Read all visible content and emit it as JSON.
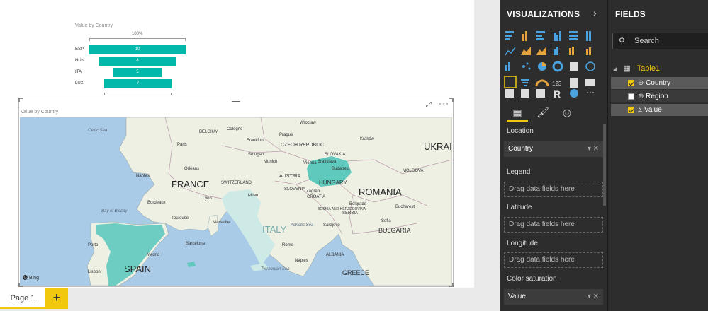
{
  "funnel": {
    "title": "Value by Country",
    "top_label": "100%",
    "rows": [
      {
        "label": "ESP",
        "value": "10"
      },
      {
        "label": "HUN",
        "value": "8"
      },
      {
        "label": "ITA",
        "value": "5"
      },
      {
        "label": "LUX",
        "value": "7"
      }
    ]
  },
  "map_visual": {
    "title": "Value by Country",
    "provider": "Bing",
    "labels": {
      "france": "FRANCE",
      "spain": "SPAIN",
      "italy": "ITALY",
      "hungary": "HUNGARY",
      "romania": "ROMANIA",
      "bulgaria": "BULGARIA",
      "greece": "GREECE",
      "austria": "AUSTRIA",
      "switzerland": "SWITZERLAND",
      "czech": "CZECH REPUBLIC",
      "slovakia": "SLOVAKIA",
      "serbia": "SERBIA",
      "croatia": "CROATIA",
      "belgium": "BELGIUM",
      "ukraine": "UKRAI",
      "slovenia": "SLOVENIA",
      "bosnia": "BOSNIA AND HERZEGOVINA",
      "albania": "ALBANIA",
      "moldova": "MOLDOVA",
      "celtic": "Celtic Sea",
      "biscay": "Bay of Biscay",
      "tyrrhenian": "Tyrrhenian Sea",
      "adriatic": "Adriatic Sea",
      "paris": "Paris",
      "madrid": "Madrid",
      "rome": "Rome",
      "vienna": "Vienna",
      "budapest": "Budapest",
      "prague": "Prague",
      "bucharest": "Bucharest",
      "munich": "Munich",
      "milan": "Milan",
      "barcelona": "Barcelona",
      "lisbon": "Lisbon",
      "belgrade": "Belgrade",
      "sofia": "Sofia",
      "cologne": "Cologne",
      "lyon": "Lyon",
      "toulouse": "Toulouse",
      "marseille": "Marseille",
      "bordeaux": "Bordeaux",
      "stuttgart": "Stuttgart",
      "frankfurt": "Frankfurt",
      "zagreb": "Zagreb",
      "sarajevo": "Sarajevo",
      "naples": "Naples",
      "bratislava": "Bratislava",
      "kraków": "Kraków",
      "warsaw": "Wrocław",
      "porto": "Porto",
      "nantes": "Nantes",
      "orleans": "Orléans"
    }
  },
  "page_tabs": {
    "page1": "Page 1",
    "add": "+"
  },
  "visualizations": {
    "header": "VISUALIZATIONS",
    "wells": {
      "location_label": "Location",
      "location_value": "Country",
      "legend_label": "Legend",
      "legend_placeholder": "Drag data fields here",
      "latitude_label": "Latitude",
      "latitude_placeholder": "Drag data fields here",
      "longitude_label": "Longitude",
      "longitude_placeholder": "Drag data fields here",
      "color_label": "Color saturation",
      "color_value": "Value"
    }
  },
  "fields": {
    "header": "FIELDS",
    "search_placeholder": "Search",
    "table_name": "Table1",
    "items": [
      {
        "name": "Country",
        "checked": true
      },
      {
        "name": "Region",
        "checked": false
      },
      {
        "name": "Value",
        "checked": true
      }
    ]
  },
  "colors": {
    "accent": "#f2c80f",
    "teal": "#01b8aa",
    "panel": "#2d2d2d"
  }
}
